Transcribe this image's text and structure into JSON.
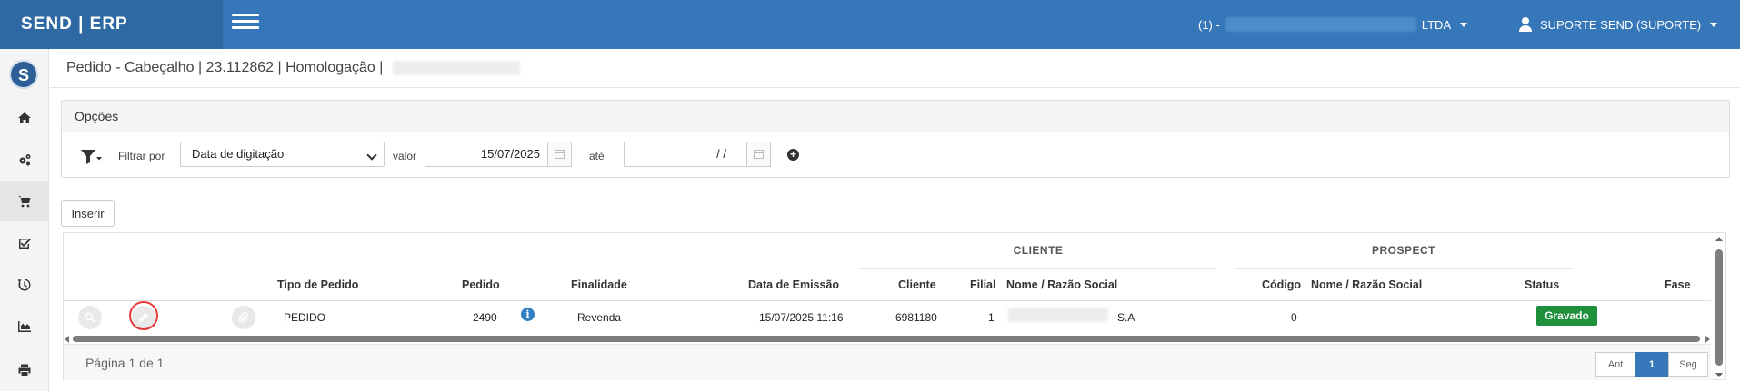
{
  "header": {
    "brand": "SEND | ERP",
    "company_prefix": "(1) -",
    "company_suffix": "LTDA",
    "user": "SUPORTE SEND (SUPORTE)"
  },
  "sidebar": {
    "logo_letter": "S",
    "items": [
      {
        "icon": "home-icon"
      },
      {
        "icon": "cogs-icon"
      },
      {
        "icon": "cart-icon"
      },
      {
        "icon": "check-square-icon"
      },
      {
        "icon": "history-icon"
      },
      {
        "icon": "chart-icon"
      },
      {
        "icon": "print-icon"
      }
    ]
  },
  "page": {
    "title": "Pedido - Cabeçalho | 23.112862 | Homologação |"
  },
  "options": {
    "title": "Opções",
    "filter_by_label": "Filtrar por",
    "filter_field": "Data de digitação",
    "valor_label": "valor",
    "date_from": "15/07/2025",
    "ate_label": "até",
    "date_to": "/ /"
  },
  "actions": {
    "insert_label": "Inserir"
  },
  "table": {
    "groups": {
      "cliente": "CLIENTE",
      "prospect": "PROSPECT"
    },
    "columns": {
      "tipo": "Tipo de Pedido",
      "pedido": "Pedido",
      "finalidade": "Finalidade",
      "emissao": "Data de Emissão",
      "cliente": "Cliente",
      "filial": "Filial",
      "nome_cliente": "Nome / Razão Social",
      "codigo": "Código",
      "nome_prospect": "Nome / Razão Social",
      "status": "Status",
      "fase": "Fase"
    },
    "row": {
      "tipo": "PEDIDO",
      "pedido": "2490",
      "finalidade": "Revenda",
      "emissao": "15/07/2025 11:16",
      "cliente": "6981180",
      "filial": "1",
      "nome_cliente_suffix": "S.A",
      "codigo": "0",
      "status": "Gravado",
      "status_color": "#1e8f3a"
    }
  },
  "pagination": {
    "info": "Página 1 de 1",
    "prev": "Ant",
    "current": "1",
    "next": "Seg"
  }
}
